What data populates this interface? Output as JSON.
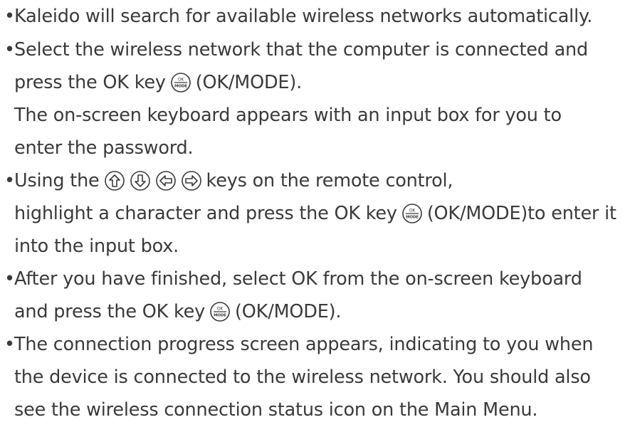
{
  "items": [
    {
      "bullet": "•",
      "line1": "Kaleido will search for available wireless networks automatically."
    },
    {
      "bullet": "•",
      "line1": "Select the wireless network that the computer is connected and",
      "line2_before": "press the OK key",
      "line2_after": "(OK/MODE).",
      "line3": "The on-screen keyboard appears with an input box for you to",
      "line4": "enter the password."
    },
    {
      "bullet": "•",
      "line1_before": "Using the",
      "line1_after": "keys on the remote control,",
      "line2_before": "highlight a character and press the OK key",
      "line2_after": "(OK/MODE)to enter it",
      "line3": "into the input box."
    },
    {
      "bullet": "•",
      "line1": "After you have finished, select OK from the on-screen keyboard",
      "line2_before": "and press the OK key",
      "line2_after": "(OK/MODE)."
    },
    {
      "bullet": "•",
      "line1": "The connection progress screen appears, indicating to you when",
      "line2": "the device is connected to the wireless network.  You should also",
      "line3": "see the wireless connection status icon on the Main Menu."
    }
  ],
  "ok_button_icon": {
    "top_text": "OK",
    "bottom_text": "MODE"
  },
  "icons": [
    "up-arrow-icon",
    "down-arrow-icon",
    "left-arrow-icon",
    "right-arrow-icon",
    "ok-mode-button-icon"
  ],
  "colors": {
    "text": "#3a3a3a"
  }
}
